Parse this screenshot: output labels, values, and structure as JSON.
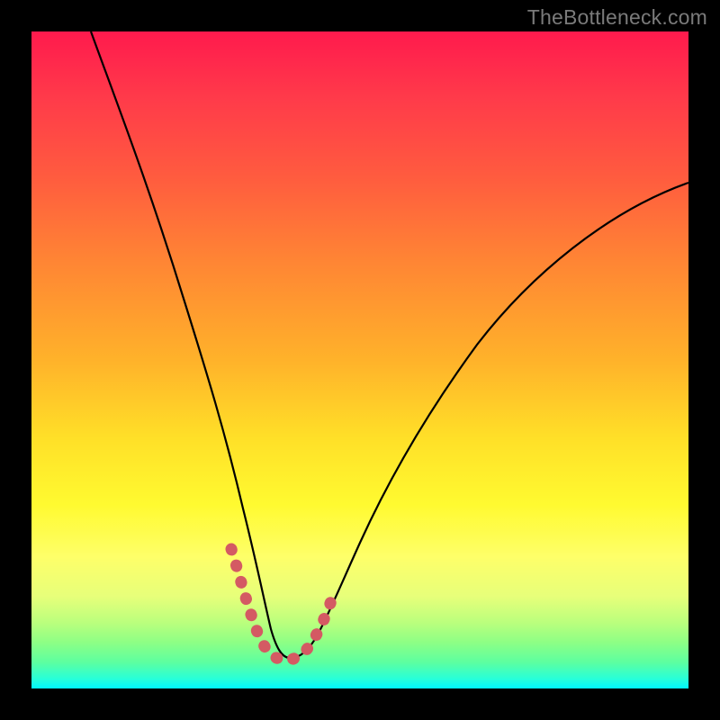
{
  "watermark": "TheBottleneck.com",
  "chart_data": {
    "type": "line",
    "title": "",
    "xlabel": "",
    "ylabel": "",
    "xlim": [
      0,
      100
    ],
    "ylim": [
      0,
      100
    ],
    "series": [
      {
        "name": "bottleneck-curve",
        "x": [
          9,
          12,
          16,
          20,
          24,
          28,
          31,
          33,
          34.5,
          36,
          37.5,
          39,
          41,
          43,
          46,
          50,
          55,
          62,
          70,
          80,
          92,
          100
        ],
        "values": [
          100,
          92,
          82,
          70,
          56,
          40,
          26,
          16,
          10,
          6.5,
          5.5,
          5.5,
          6.5,
          9,
          13,
          20,
          28,
          38,
          48,
          58,
          68,
          73
        ]
      },
      {
        "name": "highlight-zone",
        "x": [
          30.5,
          32,
          33.5,
          35,
          37,
          39,
          41,
          42.5,
          44,
          45.5
        ],
        "values": [
          22,
          15,
          10,
          7,
          5.5,
          5.5,
          6.5,
          8,
          11,
          14.5
        ]
      }
    ],
    "background_gradient": {
      "top": "#ff1a4d",
      "mid": "#ffe028",
      "bottom": "#00f7ff"
    }
  }
}
